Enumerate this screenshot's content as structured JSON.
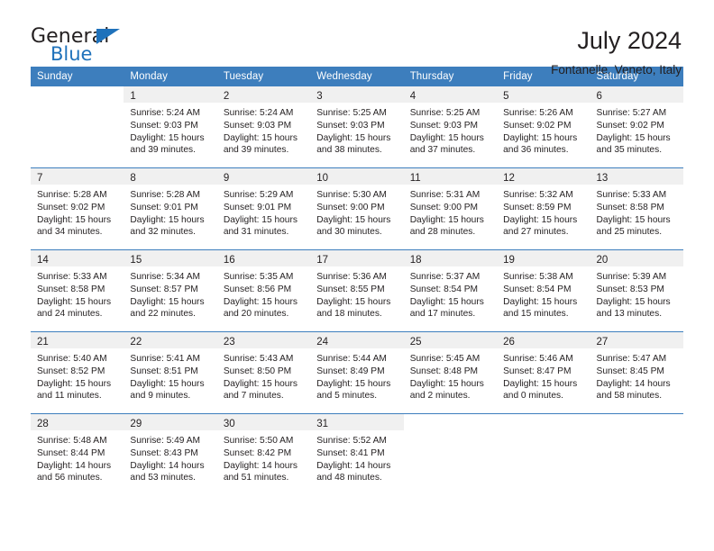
{
  "brand": {
    "name_part1": "General",
    "name_part2": "Blue",
    "triangle_color": "#1f72bb",
    "text_color": "#231f20"
  },
  "header": {
    "title": "July 2024",
    "subtitle": "Fontanelle, Veneto, Italy"
  },
  "theme": {
    "header_row_bg": "#3d7ebd",
    "header_row_text": "#ffffff",
    "daynum_band_bg": "#f0f0f0",
    "separator": "#3d7ebd",
    "body_text": "#231f20"
  },
  "calendar": {
    "columns": [
      "Sunday",
      "Monday",
      "Tuesday",
      "Wednesday",
      "Thursday",
      "Friday",
      "Saturday"
    ],
    "weeks": [
      [
        {
          "day": "",
          "lines": []
        },
        {
          "day": "1",
          "lines": [
            "Sunrise: 5:24 AM",
            "Sunset: 9:03 PM",
            "Daylight: 15 hours",
            "and 39 minutes."
          ]
        },
        {
          "day": "2",
          "lines": [
            "Sunrise: 5:24 AM",
            "Sunset: 9:03 PM",
            "Daylight: 15 hours",
            "and 39 minutes."
          ]
        },
        {
          "day": "3",
          "lines": [
            "Sunrise: 5:25 AM",
            "Sunset: 9:03 PM",
            "Daylight: 15 hours",
            "and 38 minutes."
          ]
        },
        {
          "day": "4",
          "lines": [
            "Sunrise: 5:25 AM",
            "Sunset: 9:03 PM",
            "Daylight: 15 hours",
            "and 37 minutes."
          ]
        },
        {
          "day": "5",
          "lines": [
            "Sunrise: 5:26 AM",
            "Sunset: 9:02 PM",
            "Daylight: 15 hours",
            "and 36 minutes."
          ]
        },
        {
          "day": "6",
          "lines": [
            "Sunrise: 5:27 AM",
            "Sunset: 9:02 PM",
            "Daylight: 15 hours",
            "and 35 minutes."
          ]
        }
      ],
      [
        {
          "day": "7",
          "lines": [
            "Sunrise: 5:28 AM",
            "Sunset: 9:02 PM",
            "Daylight: 15 hours",
            "and 34 minutes."
          ]
        },
        {
          "day": "8",
          "lines": [
            "Sunrise: 5:28 AM",
            "Sunset: 9:01 PM",
            "Daylight: 15 hours",
            "and 32 minutes."
          ]
        },
        {
          "day": "9",
          "lines": [
            "Sunrise: 5:29 AM",
            "Sunset: 9:01 PM",
            "Daylight: 15 hours",
            "and 31 minutes."
          ]
        },
        {
          "day": "10",
          "lines": [
            "Sunrise: 5:30 AM",
            "Sunset: 9:00 PM",
            "Daylight: 15 hours",
            "and 30 minutes."
          ]
        },
        {
          "day": "11",
          "lines": [
            "Sunrise: 5:31 AM",
            "Sunset: 9:00 PM",
            "Daylight: 15 hours",
            "and 28 minutes."
          ]
        },
        {
          "day": "12",
          "lines": [
            "Sunrise: 5:32 AM",
            "Sunset: 8:59 PM",
            "Daylight: 15 hours",
            "and 27 minutes."
          ]
        },
        {
          "day": "13",
          "lines": [
            "Sunrise: 5:33 AM",
            "Sunset: 8:58 PM",
            "Daylight: 15 hours",
            "and 25 minutes."
          ]
        }
      ],
      [
        {
          "day": "14",
          "lines": [
            "Sunrise: 5:33 AM",
            "Sunset: 8:58 PM",
            "Daylight: 15 hours",
            "and 24 minutes."
          ]
        },
        {
          "day": "15",
          "lines": [
            "Sunrise: 5:34 AM",
            "Sunset: 8:57 PM",
            "Daylight: 15 hours",
            "and 22 minutes."
          ]
        },
        {
          "day": "16",
          "lines": [
            "Sunrise: 5:35 AM",
            "Sunset: 8:56 PM",
            "Daylight: 15 hours",
            "and 20 minutes."
          ]
        },
        {
          "day": "17",
          "lines": [
            "Sunrise: 5:36 AM",
            "Sunset: 8:55 PM",
            "Daylight: 15 hours",
            "and 18 minutes."
          ]
        },
        {
          "day": "18",
          "lines": [
            "Sunrise: 5:37 AM",
            "Sunset: 8:54 PM",
            "Daylight: 15 hours",
            "and 17 minutes."
          ]
        },
        {
          "day": "19",
          "lines": [
            "Sunrise: 5:38 AM",
            "Sunset: 8:54 PM",
            "Daylight: 15 hours",
            "and 15 minutes."
          ]
        },
        {
          "day": "20",
          "lines": [
            "Sunrise: 5:39 AM",
            "Sunset: 8:53 PM",
            "Daylight: 15 hours",
            "and 13 minutes."
          ]
        }
      ],
      [
        {
          "day": "21",
          "lines": [
            "Sunrise: 5:40 AM",
            "Sunset: 8:52 PM",
            "Daylight: 15 hours",
            "and 11 minutes."
          ]
        },
        {
          "day": "22",
          "lines": [
            "Sunrise: 5:41 AM",
            "Sunset: 8:51 PM",
            "Daylight: 15 hours",
            "and 9 minutes."
          ]
        },
        {
          "day": "23",
          "lines": [
            "Sunrise: 5:43 AM",
            "Sunset: 8:50 PM",
            "Daylight: 15 hours",
            "and 7 minutes."
          ]
        },
        {
          "day": "24",
          "lines": [
            "Sunrise: 5:44 AM",
            "Sunset: 8:49 PM",
            "Daylight: 15 hours",
            "and 5 minutes."
          ]
        },
        {
          "day": "25",
          "lines": [
            "Sunrise: 5:45 AM",
            "Sunset: 8:48 PM",
            "Daylight: 15 hours",
            "and 2 minutes."
          ]
        },
        {
          "day": "26",
          "lines": [
            "Sunrise: 5:46 AM",
            "Sunset: 8:47 PM",
            "Daylight: 15 hours",
            "and 0 minutes."
          ]
        },
        {
          "day": "27",
          "lines": [
            "Sunrise: 5:47 AM",
            "Sunset: 8:45 PM",
            "Daylight: 14 hours",
            "and 58 minutes."
          ]
        }
      ],
      [
        {
          "day": "28",
          "lines": [
            "Sunrise: 5:48 AM",
            "Sunset: 8:44 PM",
            "Daylight: 14 hours",
            "and 56 minutes."
          ]
        },
        {
          "day": "29",
          "lines": [
            "Sunrise: 5:49 AM",
            "Sunset: 8:43 PM",
            "Daylight: 14 hours",
            "and 53 minutes."
          ]
        },
        {
          "day": "30",
          "lines": [
            "Sunrise: 5:50 AM",
            "Sunset: 8:42 PM",
            "Daylight: 14 hours",
            "and 51 minutes."
          ]
        },
        {
          "day": "31",
          "lines": [
            "Sunrise: 5:52 AM",
            "Sunset: 8:41 PM",
            "Daylight: 14 hours",
            "and 48 minutes."
          ]
        },
        {
          "day": "",
          "lines": []
        },
        {
          "day": "",
          "lines": []
        },
        {
          "day": "",
          "lines": []
        }
      ]
    ]
  }
}
